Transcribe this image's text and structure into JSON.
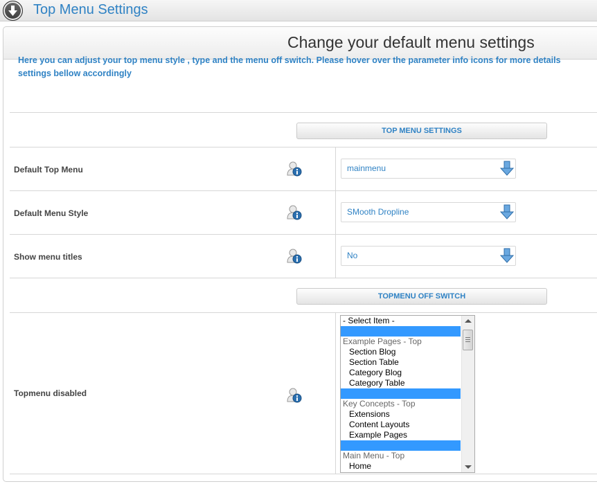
{
  "header": {
    "title": "Top Menu Settings",
    "icon": "down-arrow-icon"
  },
  "panel": {
    "heading": "Change your default menu settings",
    "intro_line1": "Here you can adjust your top menu style , type and the menu off switch. Please hover over the parameter info icons for more details",
    "intro_line2": "settings bellow accordingly"
  },
  "sections": {
    "top_menu_settings": "TOP MENU SETTINGS",
    "topmenu_off_switch": "TOPMENU OFF SWITCH"
  },
  "fields": [
    {
      "label": "Default Top Menu",
      "value": "mainmenu"
    },
    {
      "label": "Default Menu Style",
      "value": "SMooth Dropline"
    },
    {
      "label": "Show menu titles",
      "value": "No"
    }
  ],
  "topmenu_disabled": {
    "label": "Topmenu disabled",
    "options": [
      {
        "text": "- Select Item -",
        "kind": "item"
      },
      {
        "text": "",
        "kind": "separator"
      },
      {
        "text": "Example Pages - Top",
        "kind": "group"
      },
      {
        "text": "Section Blog",
        "kind": "sub"
      },
      {
        "text": "Section Table",
        "kind": "sub"
      },
      {
        "text": "Category Blog",
        "kind": "sub"
      },
      {
        "text": "Category Table",
        "kind": "sub"
      },
      {
        "text": "",
        "kind": "separator"
      },
      {
        "text": "Key Concepts - Top",
        "kind": "group"
      },
      {
        "text": "Extensions",
        "kind": "sub"
      },
      {
        "text": "Content Layouts",
        "kind": "sub"
      },
      {
        "text": "Example Pages",
        "kind": "sub"
      },
      {
        "text": "",
        "kind": "separator"
      },
      {
        "text": "Main Menu - Top",
        "kind": "group"
      },
      {
        "text": "Home",
        "kind": "sub"
      }
    ]
  },
  "colors": {
    "accent": "#2f82c4",
    "selection": "#3399ff"
  }
}
